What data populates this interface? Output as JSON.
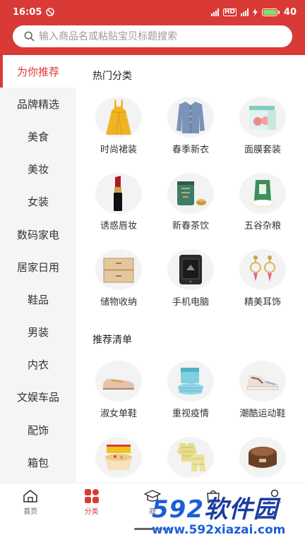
{
  "status_bar": {
    "time": "16:05",
    "battery": "40",
    "net_label": "HD"
  },
  "search": {
    "placeholder": "输入商品名或粘贴宝贝标题搜索"
  },
  "sidebar": {
    "items": [
      {
        "label": "为你推荐",
        "active": true
      },
      {
        "label": "品牌精选"
      },
      {
        "label": "美食"
      },
      {
        "label": "美妆"
      },
      {
        "label": "女装"
      },
      {
        "label": "数码家电"
      },
      {
        "label": "居家日用"
      },
      {
        "label": "鞋品"
      },
      {
        "label": "男装"
      },
      {
        "label": "内衣"
      },
      {
        "label": "文娱车品"
      },
      {
        "label": "配饰"
      },
      {
        "label": "箱包"
      }
    ]
  },
  "main": {
    "hot_title": "热门分类",
    "hot_items": [
      {
        "label": "时尚裙装",
        "icon": "dress-icon"
      },
      {
        "label": "春季新衣",
        "icon": "shirt-icon"
      },
      {
        "label": "面膜套装",
        "icon": "mask-box-icon"
      },
      {
        "label": "诱惑唇妆",
        "icon": "lipstick-icon"
      },
      {
        "label": "新春茶饮",
        "icon": "tea-can-icon"
      },
      {
        "label": "五谷杂粮",
        "icon": "rice-bag-icon"
      },
      {
        "label": "储物收纳",
        "icon": "drawer-icon"
      },
      {
        "label": "手机电脑",
        "icon": "phone-icon"
      },
      {
        "label": "精美耳饰",
        "icon": "earring-icon"
      }
    ],
    "rec_title": "推荐清单",
    "rec_items": [
      {
        "label": "淑女单鞋",
        "icon": "loafer-icon"
      },
      {
        "label": "重视疫情",
        "icon": "face-mask-icon"
      },
      {
        "label": "潮酷运动鞋",
        "icon": "sneaker-icon"
      },
      {
        "label": "",
        "icon": "noodle-cup-icon"
      },
      {
        "label": "",
        "icon": "pajama-icon"
      },
      {
        "label": "",
        "icon": "rice-cooker-icon"
      }
    ]
  },
  "bottom_nav": {
    "items": [
      {
        "label": "首页",
        "icon": "home-icon"
      },
      {
        "label": "分类",
        "icon": "category-icon",
        "active": true
      },
      {
        "label": "商",
        "icon": "graduation-cap-icon"
      },
      {
        "label": "",
        "icon": "bag-icon"
      },
      {
        "label": "",
        "icon": "user-icon"
      }
    ]
  },
  "watermark": {
    "brand_num": "592",
    "brand_cn": "软件园",
    "url": "www.592xiazai.com"
  },
  "colors": {
    "accent": "#d93a36",
    "watermark": "#1c5dd8"
  }
}
